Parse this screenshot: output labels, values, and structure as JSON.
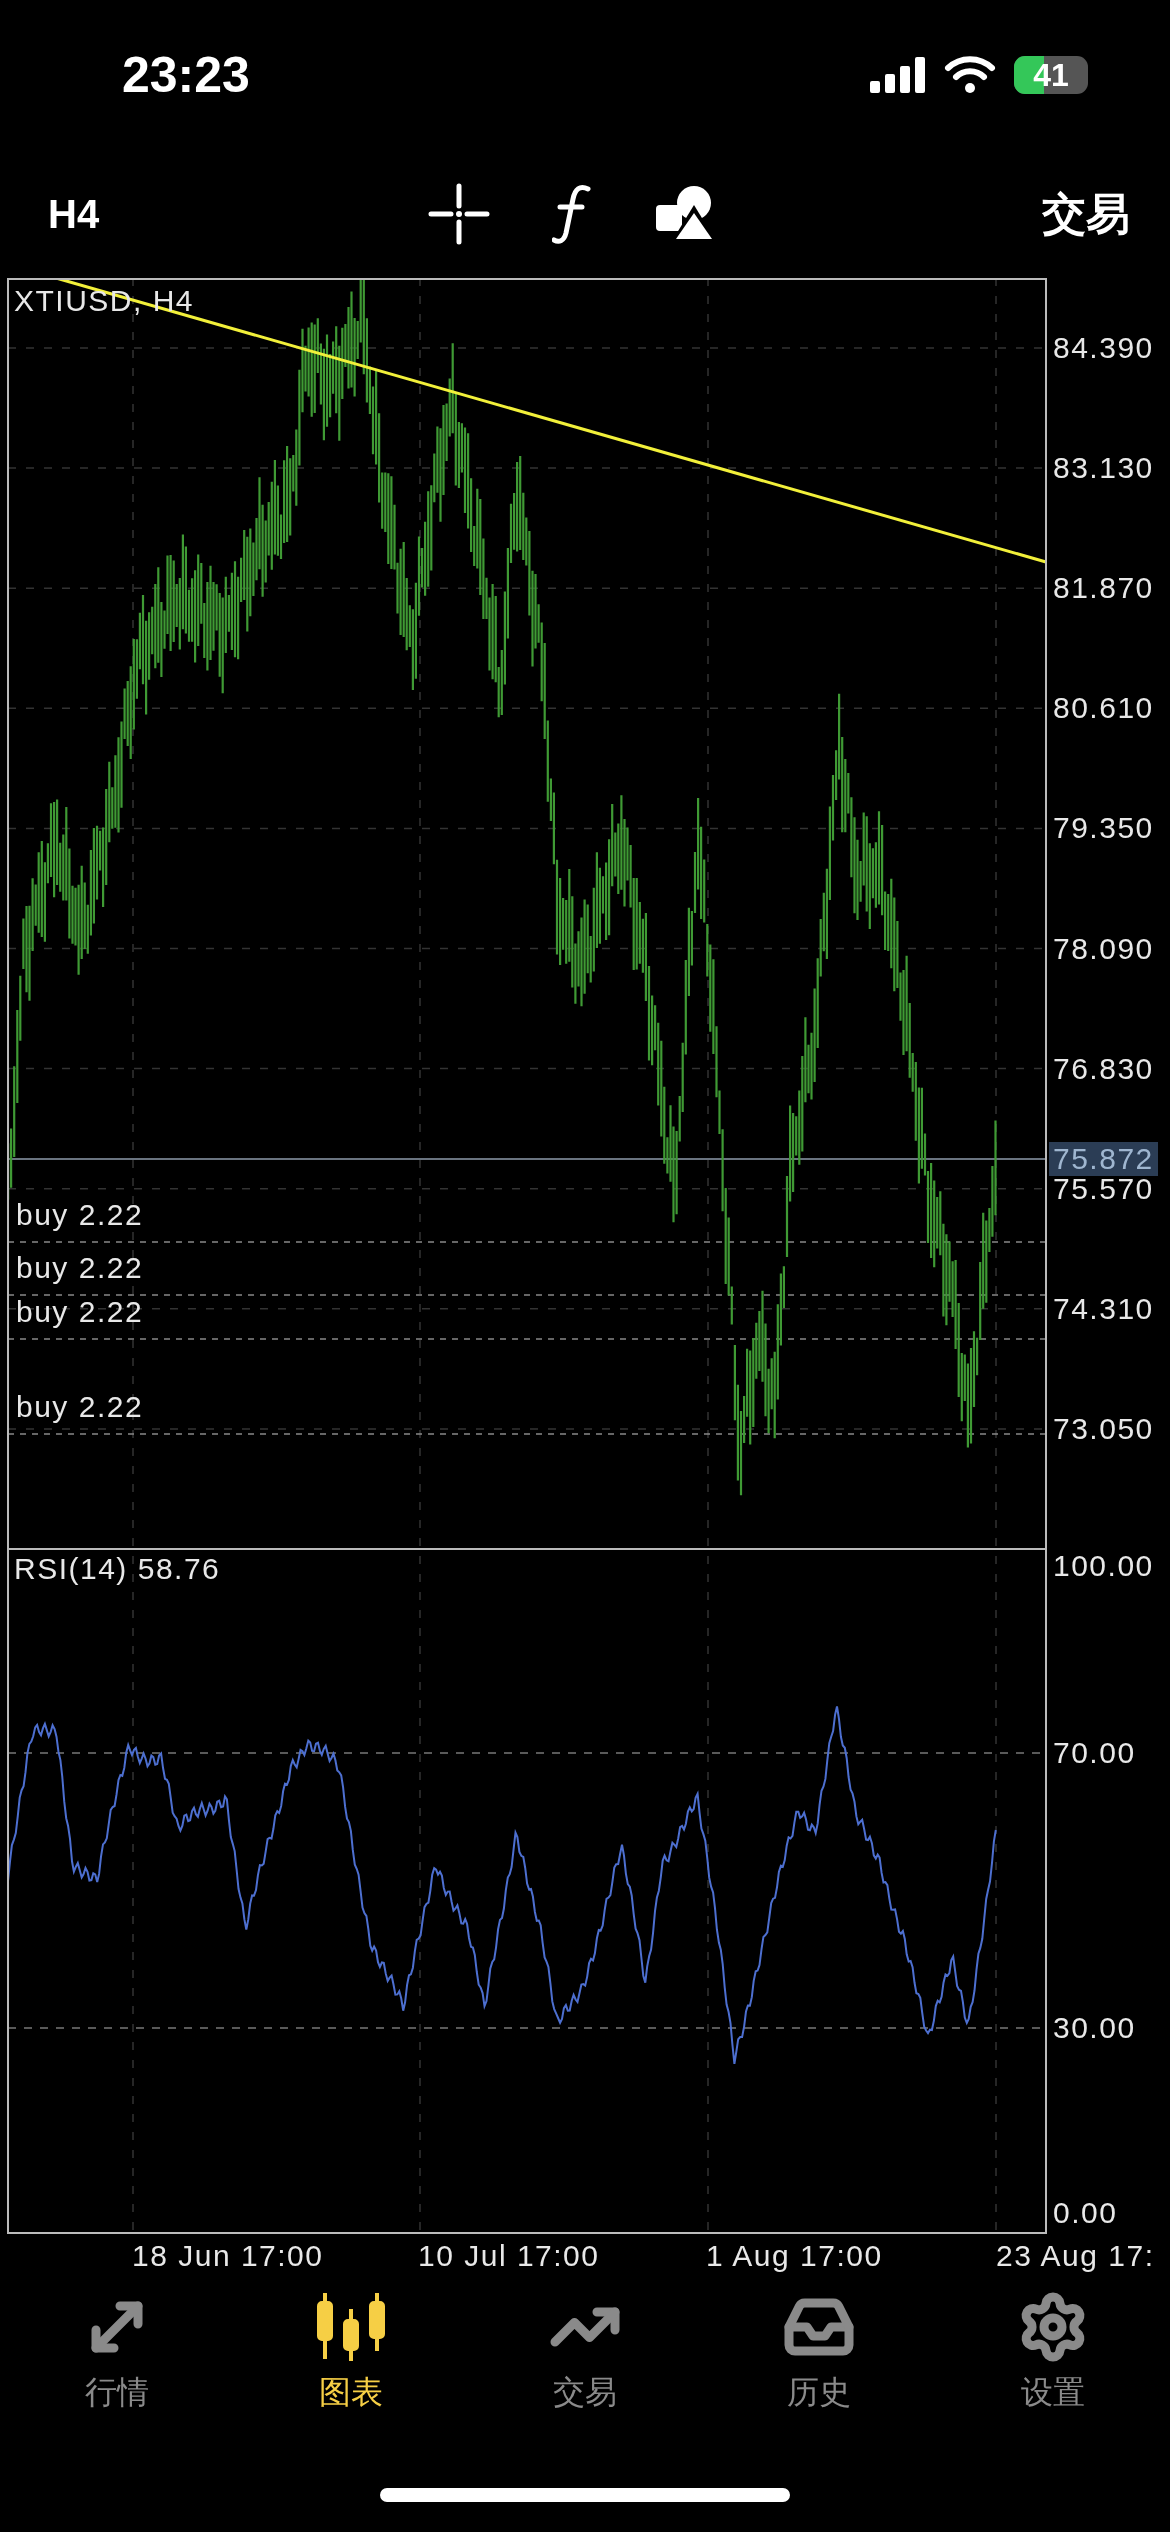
{
  "status_bar": {
    "time": "23:23",
    "battery": "41"
  },
  "toolbar": {
    "timeframe": "H4",
    "trade_label": "交易"
  },
  "chart": {
    "symbol_label": "XTIUSD, H4",
    "price_ticks": [
      "84.390",
      "83.130",
      "81.870",
      "80.610",
      "79.350",
      "78.090",
      "76.830",
      "75.570",
      "74.310",
      "73.050"
    ],
    "current_price": "75.872",
    "orders": [
      {
        "label": "buy 2.22"
      },
      {
        "label": "buy 2.22"
      },
      {
        "label": "buy 2.22"
      },
      {
        "label": "buy 2.22"
      }
    ],
    "indicator_label": "RSI(14) 58.76",
    "indicator_ticks": [
      "100.00",
      "70.00",
      "30.00",
      "0.00"
    ],
    "time_ticks": [
      "18 Jun 17:00",
      "10 Jul 17:00",
      "1 Aug 17:00",
      "23 Aug 17:"
    ]
  },
  "tabs": [
    {
      "label": "行情",
      "selected": false
    },
    {
      "label": "图表",
      "selected": true
    },
    {
      "label": "交易",
      "selected": false
    },
    {
      "label": "历史",
      "selected": false
    },
    {
      "label": "设置",
      "selected": false
    }
  ]
}
